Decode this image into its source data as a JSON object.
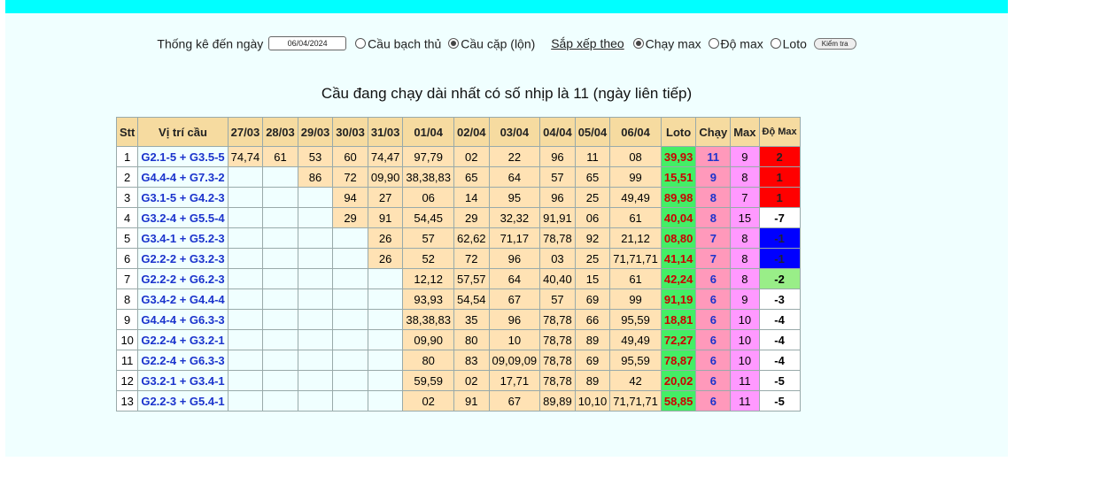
{
  "form": {
    "label_date": "Thống kê đến ngày",
    "date_value": "06/04/2024",
    "opt_bach_thu": "Cầu bạch thủ",
    "opt_cap": "Cầu cặp (lộn)",
    "sort_label": "Sắp xếp theo",
    "opt_chay_max": "Chạy max",
    "opt_do_max": "Độ max",
    "opt_loto": "Loto",
    "check_button": "Kiểm tra"
  },
  "heading": "Cầu đang chạy dài nhất có số nhịp là 11 (ngày liên tiếp)",
  "table": {
    "headers": [
      "Stt",
      "Vị trí cầu",
      "27/03",
      "28/03",
      "29/03",
      "30/03",
      "31/03",
      "01/04",
      "02/04",
      "03/04",
      "04/04",
      "05/04",
      "06/04",
      "Loto",
      "Chạy",
      "Max",
      "Độ Max"
    ],
    "rows": [
      {
        "stt": "1",
        "pos": "G2.1-5 + G3.5-5",
        "days": [
          "74,74",
          "61",
          "53",
          "60",
          "74,47",
          "97,79",
          "02",
          "22",
          "96",
          "11",
          "08"
        ],
        "loto": "39,93",
        "chay": "11",
        "max": "9",
        "domax": "2",
        "color": "red"
      },
      {
        "stt": "2",
        "pos": "G4.4-4 + G7.3-2",
        "days": [
          "",
          "",
          "86",
          "72",
          "09,90",
          "38,38,83",
          "65",
          "64",
          "57",
          "65",
          "99"
        ],
        "loto": "15,51",
        "chay": "9",
        "max": "8",
        "domax": "1",
        "color": "red"
      },
      {
        "stt": "3",
        "pos": "G3.1-5 + G4.2-3",
        "days": [
          "",
          "",
          "",
          "94",
          "27",
          "06",
          "14",
          "95",
          "96",
          "25",
          "49,49"
        ],
        "loto": "89,98",
        "chay": "8",
        "max": "7",
        "domax": "1",
        "color": "red"
      },
      {
        "stt": "4",
        "pos": "G3.2-4 + G5.5-4",
        "days": [
          "",
          "",
          "",
          "29",
          "91",
          "54,45",
          "29",
          "32,32",
          "91,91",
          "06",
          "61"
        ],
        "loto": "40,04",
        "chay": "8",
        "max": "15",
        "domax": "-7",
        "color": "white"
      },
      {
        "stt": "5",
        "pos": "G3.4-1 + G5.2-3",
        "days": [
          "",
          "",
          "",
          "",
          "26",
          "57",
          "62,62",
          "71,17",
          "78,78",
          "92",
          "21,12"
        ],
        "loto": "08,80",
        "chay": "7",
        "max": "8",
        "domax": "-1",
        "color": "blue"
      },
      {
        "stt": "6",
        "pos": "G2.2-2 + G3.2-3",
        "days": [
          "",
          "",
          "",
          "",
          "26",
          "52",
          "72",
          "96",
          "03",
          "25",
          "71,71,71"
        ],
        "loto": "41,14",
        "chay": "7",
        "max": "8",
        "domax": "-1",
        "color": "blue"
      },
      {
        "stt": "7",
        "pos": "G2.2-2 + G6.2-3",
        "days": [
          "",
          "",
          "",
          "",
          "",
          "12,12",
          "57,57",
          "64",
          "40,40",
          "15",
          "61"
        ],
        "loto": "42,24",
        "chay": "6",
        "max": "8",
        "domax": "-2",
        "color": "green"
      },
      {
        "stt": "8",
        "pos": "G3.4-2 + G4.4-4",
        "days": [
          "",
          "",
          "",
          "",
          "",
          "93,93",
          "54,54",
          "67",
          "57",
          "69",
          "99"
        ],
        "loto": "91,19",
        "chay": "6",
        "max": "9",
        "domax": "-3",
        "color": "white"
      },
      {
        "stt": "9",
        "pos": "G4.4-4 + G6.3-3",
        "days": [
          "",
          "",
          "",
          "",
          "",
          "38,38,83",
          "35",
          "96",
          "78,78",
          "66",
          "95,59"
        ],
        "loto": "18,81",
        "chay": "6",
        "max": "10",
        "domax": "-4",
        "color": "white"
      },
      {
        "stt": "10",
        "pos": "G2.2-4 + G3.2-1",
        "days": [
          "",
          "",
          "",
          "",
          "",
          "09,90",
          "80",
          "10",
          "78,78",
          "89",
          "49,49"
        ],
        "loto": "72,27",
        "chay": "6",
        "max": "10",
        "domax": "-4",
        "color": "white"
      },
      {
        "stt": "11",
        "pos": "G2.2-4 + G6.3-3",
        "days": [
          "",
          "",
          "",
          "",
          "",
          "80",
          "83",
          "09,09,09",
          "78,78",
          "69",
          "95,59"
        ],
        "loto": "78,87",
        "chay": "6",
        "max": "10",
        "domax": "-4",
        "color": "white"
      },
      {
        "stt": "12",
        "pos": "G3.2-1 + G3.4-1",
        "days": [
          "",
          "",
          "",
          "",
          "",
          "59,59",
          "02",
          "17,71",
          "78,78",
          "89",
          "42"
        ],
        "loto": "20,02",
        "chay": "6",
        "max": "11",
        "domax": "-5",
        "color": "white"
      },
      {
        "stt": "13",
        "pos": "G2.2-3 + G5.4-1",
        "days": [
          "",
          "",
          "",
          "",
          "",
          "02",
          "91",
          "67",
          "89,89",
          "10,10",
          "71,71,71"
        ],
        "loto": "58,85",
        "chay": "6",
        "max": "11",
        "domax": "-5",
        "color": "white"
      }
    ]
  },
  "colors": {
    "top_bar": "#00ffff",
    "panel": "#f0ffff",
    "loto_bg": "#44ee66",
    "chay_bg": "#ff99bb",
    "max_bg": "#ff99ff"
  }
}
